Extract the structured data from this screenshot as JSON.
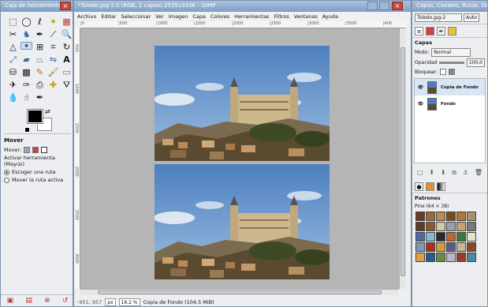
{
  "toolbox": {
    "title": "Caja de herramientas",
    "tool_icons": [
      "rect-select-icon",
      "ellipse-select-icon",
      "free-select-icon",
      "fuzzy-select-icon",
      "color-select-icon",
      "scissors-icon",
      "foreground-select-icon",
      "paths-icon",
      "color-picker-icon",
      "zoom-icon",
      "measure-icon",
      "move-icon",
      "align-icon",
      "crop-icon",
      "rotate-icon",
      "scale-icon",
      "shear-icon",
      "perspective-icon",
      "flip-icon",
      "text-icon",
      "bucket-fill-icon",
      "blend-icon",
      "pencil-icon",
      "paintbrush-icon",
      "eraser-icon",
      "airbrush-icon",
      "ink-icon",
      "clone-icon",
      "heal-icon",
      "perspective-clone-icon",
      "blur-icon",
      "smudge-icon",
      "dodge-icon"
    ],
    "options": {
      "title": "Mover",
      "mover_label": "Mover:",
      "activate_label": "Activar herramienta (Mayús)",
      "radio1": "Escoger una ruta",
      "radio2": "Mover la ruta activa"
    }
  },
  "main": {
    "title": "*Toledo.jpg-2.0 (RGB, 2 capas) 2535x3336 – GIMP",
    "menu": [
      "Archivo",
      "Editar",
      "Seleccionar",
      "Ver",
      "Imagen",
      "Capa",
      "Colores",
      "Herramientas",
      "Filtros",
      "Ventanas",
      "Ayuda"
    ],
    "ruler_h": [
      "|0",
      "|500",
      "|1000",
      "|1500",
      "|2000",
      "|2500",
      "|3000",
      "|3500",
      "|400"
    ],
    "ruler_v": [
      "500",
      "1000",
      "1500",
      "2000",
      "2500",
      "3000"
    ],
    "status": {
      "coords": "-951, 957",
      "unit": "px",
      "zoom": "16,2 %",
      "message": "Copia de Fondo (104,5 MiB)"
    }
  },
  "dock": {
    "title": "Capas, Canales, Rutas, Deshacer –",
    "image_select": "Toledo.jpg-2",
    "auto_label": "Auto",
    "layers": {
      "title": "Capas",
      "mode_label": "Modo:",
      "mode_value": "Normal",
      "opacity_label": "Opacidad",
      "opacity_value": "100,0",
      "lock_label": "Bloquear:",
      "items": [
        {
          "name": "Copia de Fondo"
        },
        {
          "name": "Fondo"
        }
      ]
    },
    "patterns": {
      "title": "Patrones",
      "subtitle": "Pine (64 × 38)",
      "swatches": [
        "#6b3a1e",
        "#9a6a3c",
        "#c08a52",
        "#7a4a20",
        "#b07838",
        "#aa8f6a",
        "#5b3b2a",
        "#8a5a30",
        "#d8c8a8",
        "#9aa0a8",
        "#c9a070",
        "#7a7a7a",
        "#4a6aa0",
        "#88b8d8",
        "#2a2a2a",
        "#b86830",
        "#3a7a3a",
        "#e8e0c8",
        "#7a9ab8",
        "#a83020",
        "#d0a040",
        "#5a5a8a",
        "#c8b890",
        "#8a4828",
        "#e0a048",
        "#2a5a8a",
        "#6a8a4a",
        "#b8b8c8",
        "#9a3a2a",
        "#4a8aa0"
      ]
    }
  }
}
